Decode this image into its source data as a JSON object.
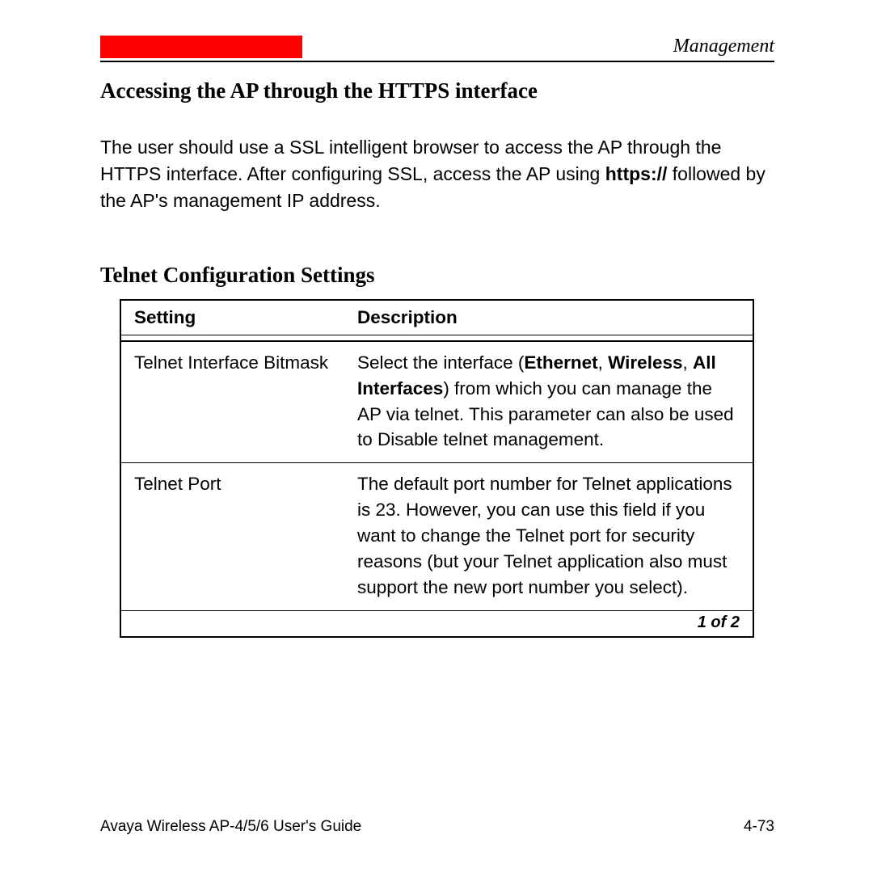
{
  "header": {
    "section_label": "Management"
  },
  "heading1": "Accessing the AP through the HTTPS interface",
  "para": {
    "pre": "The user should use a SSL intelligent browser to access the AP through the HTTPS interface. After configuring SSL, access the AP using ",
    "bold": "https://",
    "post": " followed by the AP's management IP address."
  },
  "heading2": "Telnet Configuration Settings",
  "table": {
    "headers": {
      "col1": "Setting",
      "col2": "Description"
    },
    "rows": [
      {
        "setting": "Telnet Interface Bitmask",
        "desc_pre": "Select the interface (",
        "desc_b1": "Ethernet",
        "desc_mid1": ", ",
        "desc_b2": "Wireless",
        "desc_mid2": ", ",
        "desc_b3": "All Interfaces",
        "desc_post": ") from which you can manage the AP via telnet. This parameter can also be used to Disable telnet management."
      },
      {
        "setting": "Telnet Port",
        "desc": "The default port number for Telnet applications is 23. However, you can use this field if you want to change the Telnet port for security reasons (but your Telnet application also must support the new port number you select)."
      }
    ],
    "pager": "1 of 2"
  },
  "footer": {
    "left": "Avaya Wireless AP-4/5/6 User's Guide",
    "right": "4-73"
  }
}
